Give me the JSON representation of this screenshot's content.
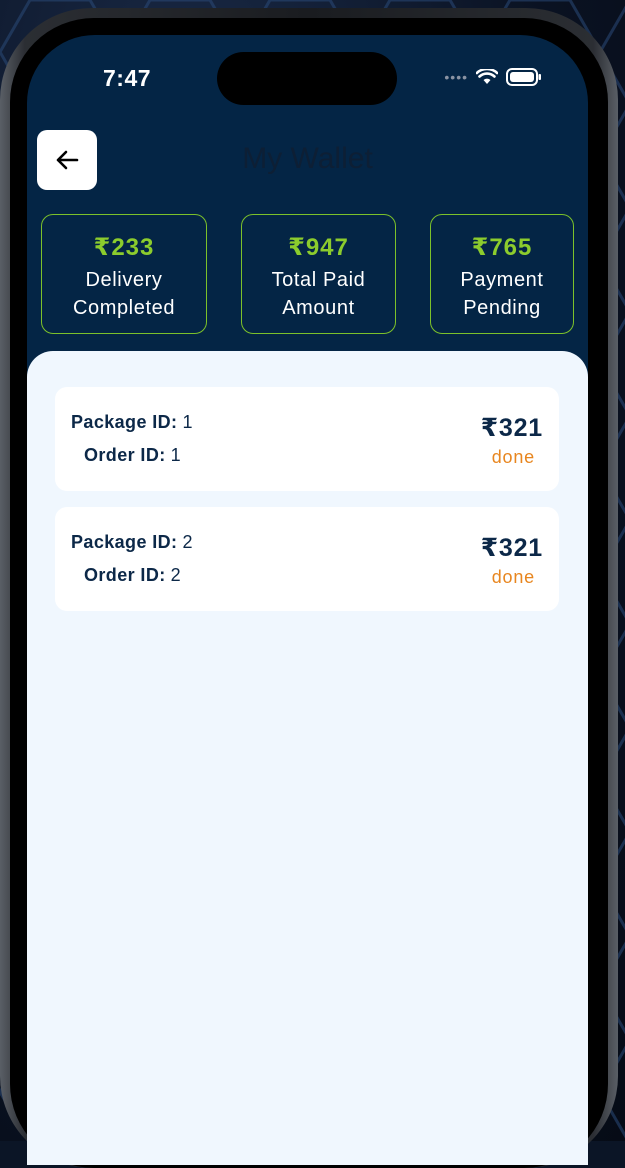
{
  "status_bar": {
    "time": "7:47",
    "signal_icon": "cellular-dots-icon",
    "wifi_icon": "wifi-icon",
    "battery_icon": "battery-icon"
  },
  "header": {
    "back_icon": "arrow-left-icon",
    "title": "My Wallet"
  },
  "summary": [
    {
      "amount": "₹233",
      "label_line1": "Delivery",
      "label_line2": "Completed"
    },
    {
      "amount": "₹947",
      "label_line1": "Total Paid",
      "label_line2": "Amount"
    },
    {
      "amount": "₹765",
      "label_line1": "Payment",
      "label_line2": "Pending"
    }
  ],
  "transactions": [
    {
      "package_label": "Package ID:",
      "package_id": "1",
      "order_label": "Order ID:",
      "order_id": "1",
      "amount": "₹321",
      "status": "done"
    },
    {
      "package_label": "Package ID:",
      "package_id": "2",
      "order_label": "Order ID:",
      "order_id": "2",
      "amount": "₹321",
      "status": "done"
    }
  ],
  "colors": {
    "header_bg": "#042545",
    "accent_green": "#8ccc2d",
    "content_bg": "#f0f7fe",
    "status_orange": "#e8861f",
    "text_navy": "#0c2848"
  }
}
